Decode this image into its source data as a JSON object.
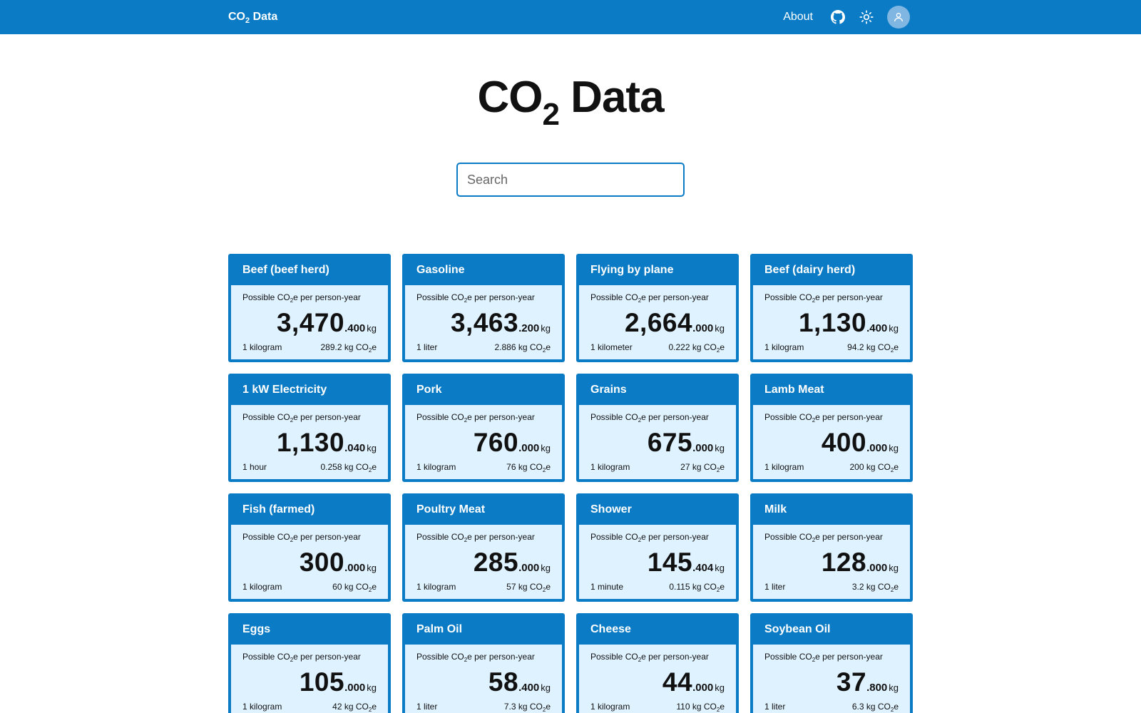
{
  "nav": {
    "brand_main": "CO",
    "brand_sub": "2",
    "brand_rest": " Data",
    "about": "About",
    "icons": [
      "github-icon",
      "sun-icon",
      "user-icon"
    ]
  },
  "title": {
    "main": "CO",
    "sub": "2",
    "rest": " Data"
  },
  "search": {
    "placeholder": "Search",
    "value": ""
  },
  "colors": {
    "accent": "#0a7bc4",
    "card_body": "#dff2ff",
    "avatar": "#7fb6e2"
  },
  "cards": [
    {
      "title": "Beef (beef herd)",
      "label_a": "Possible CO",
      "label_sub": "2",
      "label_b": "e per person-year",
      "int": "3,470",
      "dec": ".400",
      "unit": "kg",
      "per": "1 kilogram",
      "factor": "289.2 kg CO",
      "factor_sub": "2",
      "factor_end": "e"
    },
    {
      "title": "Gasoline",
      "label_a": "Possible CO",
      "label_sub": "2",
      "label_b": "e per person-year",
      "int": "3,463",
      "dec": ".200",
      "unit": "kg",
      "per": "1 liter",
      "factor": "2.886 kg CO",
      "factor_sub": "2",
      "factor_end": "e"
    },
    {
      "title": "Flying by plane",
      "label_a": "Possible CO",
      "label_sub": "2",
      "label_b": "e per person-year",
      "int": "2,664",
      "dec": ".000",
      "unit": "kg",
      "per": "1 kilometer",
      "factor": "0.222 kg CO",
      "factor_sub": "2",
      "factor_end": "e"
    },
    {
      "title": "Beef (dairy herd)",
      "label_a": "Possible CO",
      "label_sub": "2",
      "label_b": "e per person-year",
      "int": "1,130",
      "dec": ".400",
      "unit": "kg",
      "per": "1 kilogram",
      "factor": "94.2 kg CO",
      "factor_sub": "2",
      "factor_end": "e"
    },
    {
      "title": "1 kW Electricity",
      "label_a": "Possible CO",
      "label_sub": "2",
      "label_b": "e per person-year",
      "int": "1,130",
      "dec": ".040",
      "unit": "kg",
      "per": "1 hour",
      "factor": "0.258 kg CO",
      "factor_sub": "2",
      "factor_end": "e"
    },
    {
      "title": "Pork",
      "label_a": "Possible CO",
      "label_sub": "2",
      "label_b": "e per person-year",
      "int": "760",
      "dec": ".000",
      "unit": "kg",
      "per": "1 kilogram",
      "factor": "76 kg CO",
      "factor_sub": "2",
      "factor_end": "e"
    },
    {
      "title": "Grains",
      "label_a": "Possible CO",
      "label_sub": "2",
      "label_b": "e per person-year",
      "int": "675",
      "dec": ".000",
      "unit": "kg",
      "per": "1 kilogram",
      "factor": "27 kg CO",
      "factor_sub": "2",
      "factor_end": "e"
    },
    {
      "title": "Lamb Meat",
      "label_a": "Possible CO",
      "label_sub": "2",
      "label_b": "e per person-year",
      "int": "400",
      "dec": ".000",
      "unit": "kg",
      "per": "1 kilogram",
      "factor": "200 kg CO",
      "factor_sub": "2",
      "factor_end": "e"
    },
    {
      "title": "Fish (farmed)",
      "label_a": "Possible CO",
      "label_sub": "2",
      "label_b": "e per person-year",
      "int": "300",
      "dec": ".000",
      "unit": "kg",
      "per": "1 kilogram",
      "factor": "60 kg CO",
      "factor_sub": "2",
      "factor_end": "e"
    },
    {
      "title": "Poultry Meat",
      "label_a": "Possible CO",
      "label_sub": "2",
      "label_b": "e per person-year",
      "int": "285",
      "dec": ".000",
      "unit": "kg",
      "per": "1 kilogram",
      "factor": "57 kg CO",
      "factor_sub": "2",
      "factor_end": "e"
    },
    {
      "title": "Shower",
      "label_a": "Possible CO",
      "label_sub": "2",
      "label_b": "e per person-year",
      "int": "145",
      "dec": ".404",
      "unit": "kg",
      "per": "1 minute",
      "factor": "0.115 kg CO",
      "factor_sub": "2",
      "factor_end": "e"
    },
    {
      "title": "Milk",
      "label_a": "Possible CO",
      "label_sub": "2",
      "label_b": "e per person-year",
      "int": "128",
      "dec": ".000",
      "unit": "kg",
      "per": "1 liter",
      "factor": "3.2 kg CO",
      "factor_sub": "2",
      "factor_end": "e"
    },
    {
      "title": "Eggs",
      "label_a": "Possible CO",
      "label_sub": "2",
      "label_b": "e per person-year",
      "int": "105",
      "dec": ".000",
      "unit": "kg",
      "per": "1 kilogram",
      "factor": "42 kg CO",
      "factor_sub": "2",
      "factor_end": "e"
    },
    {
      "title": "Palm Oil",
      "label_a": "Possible CO",
      "label_sub": "2",
      "label_b": "e per person-year",
      "int": "58",
      "dec": ".400",
      "unit": "kg",
      "per": "1 liter",
      "factor": "7.3 kg CO",
      "factor_sub": "2",
      "factor_end": "e"
    },
    {
      "title": "Cheese",
      "label_a": "Possible CO",
      "label_sub": "2",
      "label_b": "e per person-year",
      "int": "44",
      "dec": ".000",
      "unit": "kg",
      "per": "1 kilogram",
      "factor": "110 kg CO",
      "factor_sub": "2",
      "factor_end": "e"
    },
    {
      "title": "Soybean Oil",
      "label_a": "Possible CO",
      "label_sub": "2",
      "label_b": "e per person-year",
      "int": "37",
      "dec": ".800",
      "unit": "kg",
      "per": "1 liter",
      "factor": "6.3 kg CO",
      "factor_sub": "2",
      "factor_end": "e"
    }
  ]
}
